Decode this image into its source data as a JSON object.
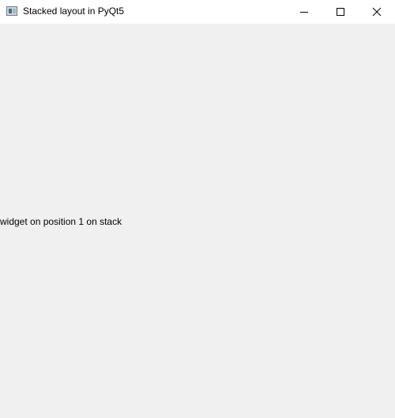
{
  "window": {
    "title": "Stacked layout in PyQt5",
    "icon": "qt-window-icon",
    "controls": [
      "minimize-icon",
      "maximize-icon",
      "close-icon"
    ]
  },
  "stack": {
    "current_widget_text": "widget on position 1 on stack"
  },
  "colors": {
    "titlebar_bg": "#ffffff",
    "client_bg": "#f0f0f0",
    "text": "#000000"
  }
}
